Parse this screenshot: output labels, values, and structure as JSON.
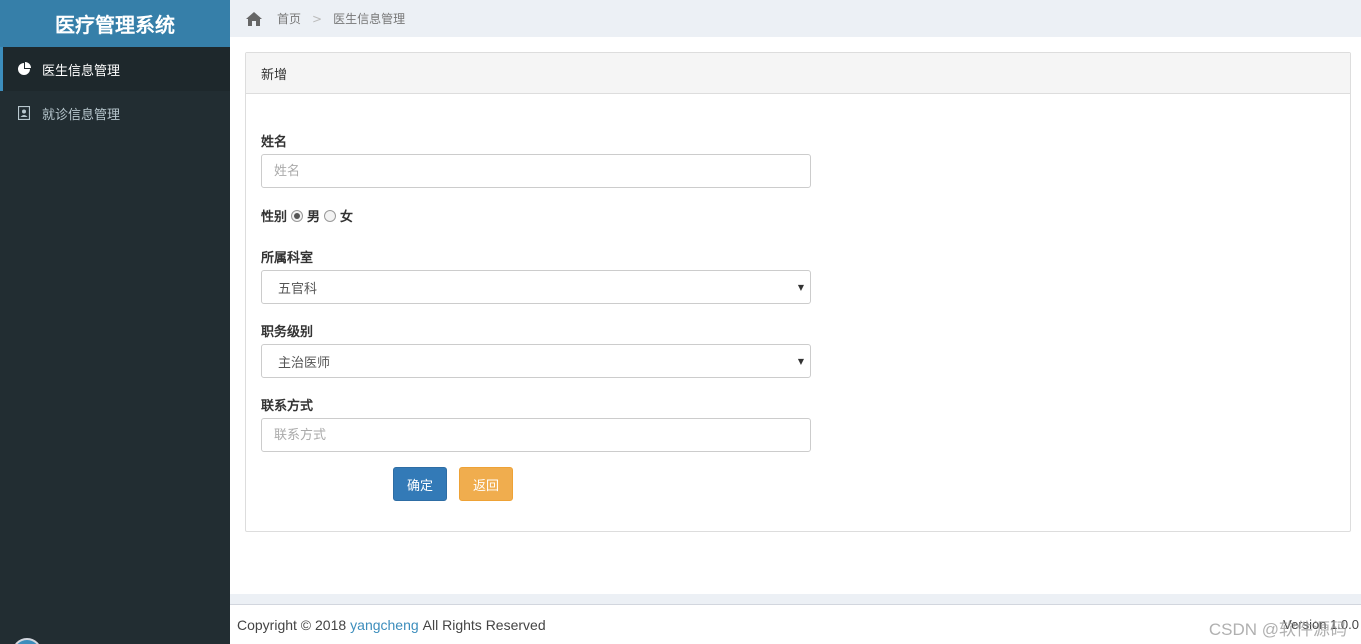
{
  "app": {
    "title": "医疗管理系统"
  },
  "sidebar": {
    "items": [
      {
        "label": "医生信息管理",
        "icon": "pie-chart-icon",
        "active": true
      },
      {
        "label": "就诊信息管理",
        "icon": "contact-card-icon",
        "active": false
      }
    ]
  },
  "breadcrumb": {
    "home": "首页",
    "separator": ">",
    "current": "医生信息管理"
  },
  "panel": {
    "title": "新增"
  },
  "form": {
    "name": {
      "label": "姓名",
      "placeholder": "姓名"
    },
    "gender": {
      "label": "性别",
      "options": [
        "男",
        "女"
      ],
      "selected": "男"
    },
    "department": {
      "label": "所属科室",
      "value": "五官科"
    },
    "rank": {
      "label": "职务级别",
      "value": "主治医师"
    },
    "contact": {
      "label": "联系方式",
      "placeholder": "联系方式"
    },
    "confirm_label": "确定",
    "back_label": "返回"
  },
  "footer": {
    "copyright_prefix": "Copyright © 2018",
    "author": "yangcheng",
    "rights": "All Rights Reserved",
    "version": "Version 1.0.0",
    "watermark": "CSDN @软件源码"
  },
  "colors": {
    "sidebar_bg": "#222d32",
    "logo_bg": "#367fa9",
    "primary": "#337ab7",
    "warning": "#f0ad4e",
    "link": "#3c8dbc"
  }
}
